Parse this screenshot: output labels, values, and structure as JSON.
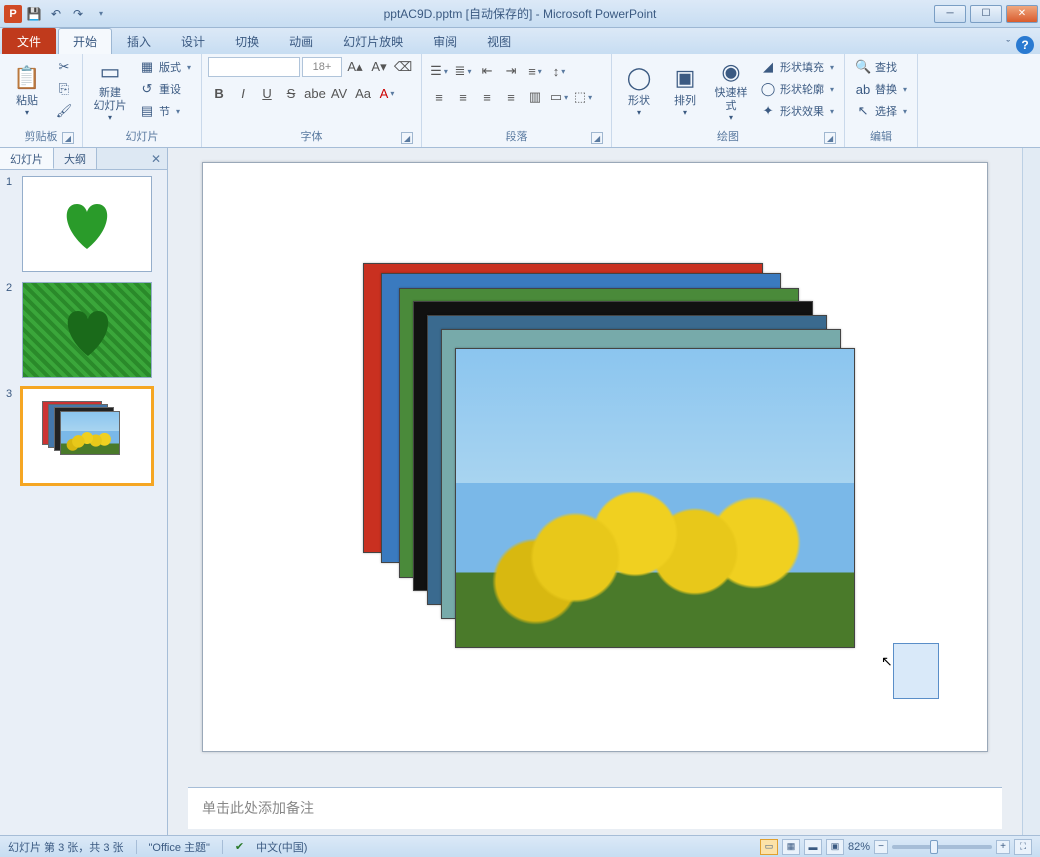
{
  "titlebar": {
    "app_letter": "P",
    "title": "pptAC9D.pptm [自动保存的] - Microsoft PowerPoint"
  },
  "tabs": {
    "file": "文件",
    "items": [
      "开始",
      "插入",
      "设计",
      "切换",
      "动画",
      "幻灯片放映",
      "审阅",
      "视图"
    ],
    "active_index": 0
  },
  "ribbon": {
    "clipboard": {
      "label": "剪贴板",
      "paste": "粘贴"
    },
    "slides": {
      "label": "幻灯片",
      "new_slide": "新建\n幻灯片",
      "layout": "版式",
      "reset": "重设",
      "section": "节"
    },
    "font": {
      "label": "字体",
      "size_placeholder": "18+"
    },
    "paragraph": {
      "label": "段落"
    },
    "drawing": {
      "label": "绘图",
      "shapes": "形状",
      "arrange": "排列",
      "quick_styles": "快速样式",
      "fill": "形状填充",
      "outline": "形状轮廓",
      "effects": "形状效果"
    },
    "editing": {
      "label": "编辑",
      "find": "查找",
      "replace": "替换",
      "select": "选择"
    }
  },
  "slide_panel": {
    "tab_slides": "幻灯片",
    "tab_outline": "大纲",
    "thumbs": [
      1,
      2,
      3
    ],
    "selected": 3
  },
  "notes": {
    "placeholder": "单击此处添加备注"
  },
  "statusbar": {
    "slide_info": "幻灯片 第 3 张，共 3 张",
    "theme": "\"Office 主题\"",
    "language": "中文(中国)",
    "zoom": "82%"
  }
}
